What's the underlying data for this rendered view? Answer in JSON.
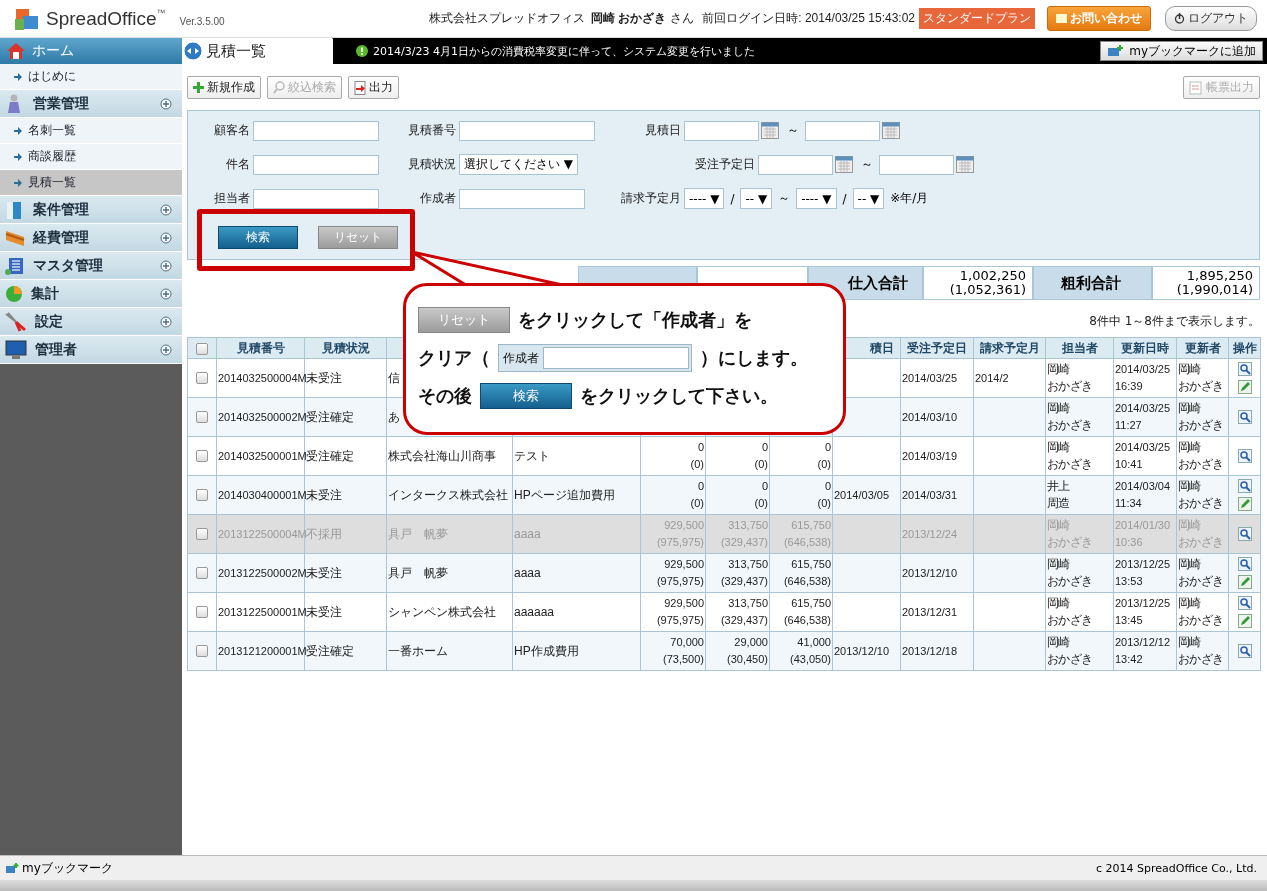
{
  "header": {
    "app_name": "SpreadOffice",
    "trademark": "™",
    "version": "Ver.3.5.00",
    "company": "株式会社スプレッドオフィス",
    "user_name": "岡崎 おかざき",
    "honorific": "さん",
    "last_login": "前回ログイン日時: 2014/03/25 15:43:02",
    "plan": "スタンダードプラン",
    "contact_button": "お問い合わせ",
    "logout_button": "ログアウト"
  },
  "sidebar": {
    "items": [
      {
        "kind": "home",
        "label": "ホーム",
        "children": [
          {
            "label": "はじめに",
            "selected": false
          }
        ]
      },
      {
        "kind": "group",
        "label": "営業管理",
        "children": [
          {
            "label": "名刺一覧",
            "selected": false
          },
          {
            "label": "商談履歴",
            "selected": false
          },
          {
            "label": "見積一覧",
            "selected": true
          }
        ]
      },
      {
        "kind": "group",
        "label": "案件管理"
      },
      {
        "kind": "group",
        "label": "経費管理"
      },
      {
        "kind": "group",
        "label": "マスタ管理"
      },
      {
        "kind": "group",
        "label": "集計"
      },
      {
        "kind": "group",
        "label": "設定"
      },
      {
        "kind": "group",
        "label": "管理者"
      }
    ]
  },
  "page_title": "見積一覧",
  "notice": "2014/3/23  4月1日からの消費税率変更に伴って、システム変更を行いました",
  "bookmark_button": "myブックマークに追加",
  "toolbar": [
    {
      "label": "新規作成",
      "kind": "new",
      "disabled": false
    },
    {
      "label": "絞込検索",
      "kind": "filter",
      "disabled": true
    },
    {
      "label": "出力",
      "kind": "export",
      "disabled": false
    }
  ],
  "report_button": {
    "label": "帳票出力",
    "disabled": true
  },
  "search_form": {
    "rows": [
      [
        {
          "kind": "text",
          "label": "顧客名"
        },
        {
          "kind": "text",
          "label": "見積番号"
        },
        {
          "kind": "daterange",
          "label": "見積日",
          "separator": "～"
        }
      ],
      [
        {
          "kind": "text",
          "label": "件名"
        },
        {
          "kind": "select",
          "label": "見積状況",
          "value": "選択してください ▼"
        },
        {
          "kind": "daterange",
          "label": "受注予定日",
          "separator": "～"
        }
      ],
      [
        {
          "kind": "text",
          "label": "担当者"
        },
        {
          "kind": "text",
          "label": "作成者"
        },
        {
          "kind": "monthrange",
          "label": "請求予定月",
          "selects": [
            "---- ▼",
            "-- ▼",
            "---- ▼",
            "-- ▼"
          ],
          "separators": [
            "/",
            "～",
            "/"
          ],
          "note": "※年/月"
        }
      ]
    ],
    "search_button": "検索",
    "reset_button": "リセット"
  },
  "summary": [
    {
      "label": "仕入合計",
      "value": "1,002,250\n(1,052,361)"
    },
    {
      "label": "粗利合計",
      "value": "1,895,250\n(1,990,014)"
    }
  ],
  "result_count": "8件中 1～8件まで表示します。",
  "table": {
    "select_all": {
      "checked": false
    },
    "columns": [
      {
        "label": "見積番号"
      },
      {
        "label": "見積状況"
      },
      {},
      {},
      {},
      {},
      {},
      {
        "label": "積日"
      },
      {
        "label": "受注予定日"
      },
      {
        "label": "請求予定月"
      },
      {
        "label": "担当者"
      },
      {
        "label": "更新日時"
      },
      {
        "label": "更新者"
      },
      {
        "label": "操作"
      }
    ],
    "rows": [
      {
        "checked": false,
        "rejected": false,
        "number": "2014032500004M",
        "status": "未受注",
        "customer": "信",
        "order_date": "2014/03/25",
        "billing_month": "2014/2",
        "staff": [
          "岡崎",
          "おかざき"
        ],
        "updated": "2014/03/25\n16:39",
        "updater": [
          "岡崎",
          "おかざき"
        ],
        "actions": [
          {
            "kind": "view"
          },
          {
            "kind": "edit"
          }
        ]
      },
      {
        "checked": false,
        "rejected": false,
        "number": "2014032500002M",
        "status": "受注確定",
        "customer": "あ",
        "order_date": "2014/03/10",
        "staff": [
          "岡崎",
          "おかざき"
        ],
        "updated": "2014/03/25\n11:27",
        "updater": [
          "岡崎",
          "おかざき"
        ],
        "actions": [
          {
            "kind": "view"
          }
        ]
      },
      {
        "checked": false,
        "rejected": false,
        "number": "2014032500001M",
        "status": "受注確定",
        "customer": "株式会社海山川商事",
        "subject": "テスト",
        "amount": "0\n(0)",
        "cost": "0\n(0)",
        "profit": "0\n(0)",
        "order_date": "2014/03/19",
        "staff": [
          "岡崎",
          "おかざき"
        ],
        "updated": "2014/03/25\n10:41",
        "updater": [
          "岡崎",
          "おかざき"
        ],
        "actions": [
          {
            "kind": "view"
          }
        ]
      },
      {
        "checked": false,
        "rejected": false,
        "number": "2014030400001M",
        "status": "未受注",
        "customer": "インタークス株式会社",
        "subject": "HPページ追加費用",
        "amount": "0\n(0)",
        "cost": "0\n(0)",
        "profit": "0\n(0)",
        "estimate_date": "2014/03/05",
        "order_date": "2014/03/31",
        "staff": [
          "井上",
          "周造"
        ],
        "updated": "2014/03/04\n11:34",
        "updater": [
          "岡崎",
          "おかざき"
        ],
        "actions": [
          {
            "kind": "view"
          },
          {
            "kind": "edit"
          }
        ]
      },
      {
        "checked": false,
        "rejected": true,
        "number": "2013122500004M",
        "status": "不採用",
        "customer": "具戸　帆夢",
        "subject": "aaaa",
        "amount": "929,500\n(975,975)",
        "cost": "313,750\n(329,437)",
        "profit": "615,750\n(646,538)",
        "order_date": "2013/12/24",
        "staff": [
          "岡崎",
          "おかざき"
        ],
        "updated": "2014/01/30\n10:36",
        "updater": [
          "岡崎",
          "おかざき"
        ],
        "actions": [
          {
            "kind": "view"
          }
        ]
      },
      {
        "checked": false,
        "rejected": false,
        "number": "2013122500002M",
        "status": "未受注",
        "customer": "具戸　帆夢",
        "subject": "aaaa",
        "amount": "929,500\n(975,975)",
        "cost": "313,750\n(329,437)",
        "profit": "615,750\n(646,538)",
        "order_date": "2013/12/10",
        "staff": [
          "岡崎",
          "おかざき"
        ],
        "updated": "2013/12/25\n13:53",
        "updater": [
          "岡崎",
          "おかざき"
        ],
        "actions": [
          {
            "kind": "view"
          },
          {
            "kind": "edit"
          }
        ]
      },
      {
        "checked": false,
        "rejected": false,
        "number": "2013122500001M",
        "status": "未受注",
        "customer": "シャンペン株式会社",
        "subject": "aaaaaa",
        "amount": "929,500\n(975,975)",
        "cost": "313,750\n(329,437)",
        "profit": "615,750\n(646,538)",
        "order_date": "2013/12/31",
        "staff": [
          "岡崎",
          "おかざき"
        ],
        "updated": "2013/12/25\n13:45",
        "updater": [
          "岡崎",
          "おかざき"
        ],
        "actions": [
          {
            "kind": "view"
          },
          {
            "kind": "edit"
          }
        ]
      },
      {
        "checked": false,
        "rejected": false,
        "number": "2013121200001M",
        "status": "受注確定",
        "customer": "一番ホーム",
        "subject": "HP作成費用",
        "amount": "70,000\n(73,500)",
        "cost": "29,000\n(30,450)",
        "profit": "41,000\n(43,050)",
        "estimate_date": "2013/12/10",
        "order_date": "2013/12/18",
        "staff": [
          "岡崎",
          "おかざき"
        ],
        "updated": "2013/12/12\n13:42",
        "updater": [
          "岡崎",
          "おかざき"
        ],
        "actions": [
          {
            "kind": "view"
          }
        ]
      }
    ]
  },
  "callout": {
    "reset_sample": "リセット",
    "line1": "をクリックして「作成者」を",
    "line2_before": "クリア（",
    "field_label": "作成者",
    "line2_after": "）にします。",
    "line3_before": "その後",
    "search_sample": "検索",
    "line3_after": "をクリックして下さい。"
  },
  "footer": {
    "bookmarks": "myブックマーク",
    "copyright": "c 2014 SpreadOffice Co., Ltd."
  }
}
